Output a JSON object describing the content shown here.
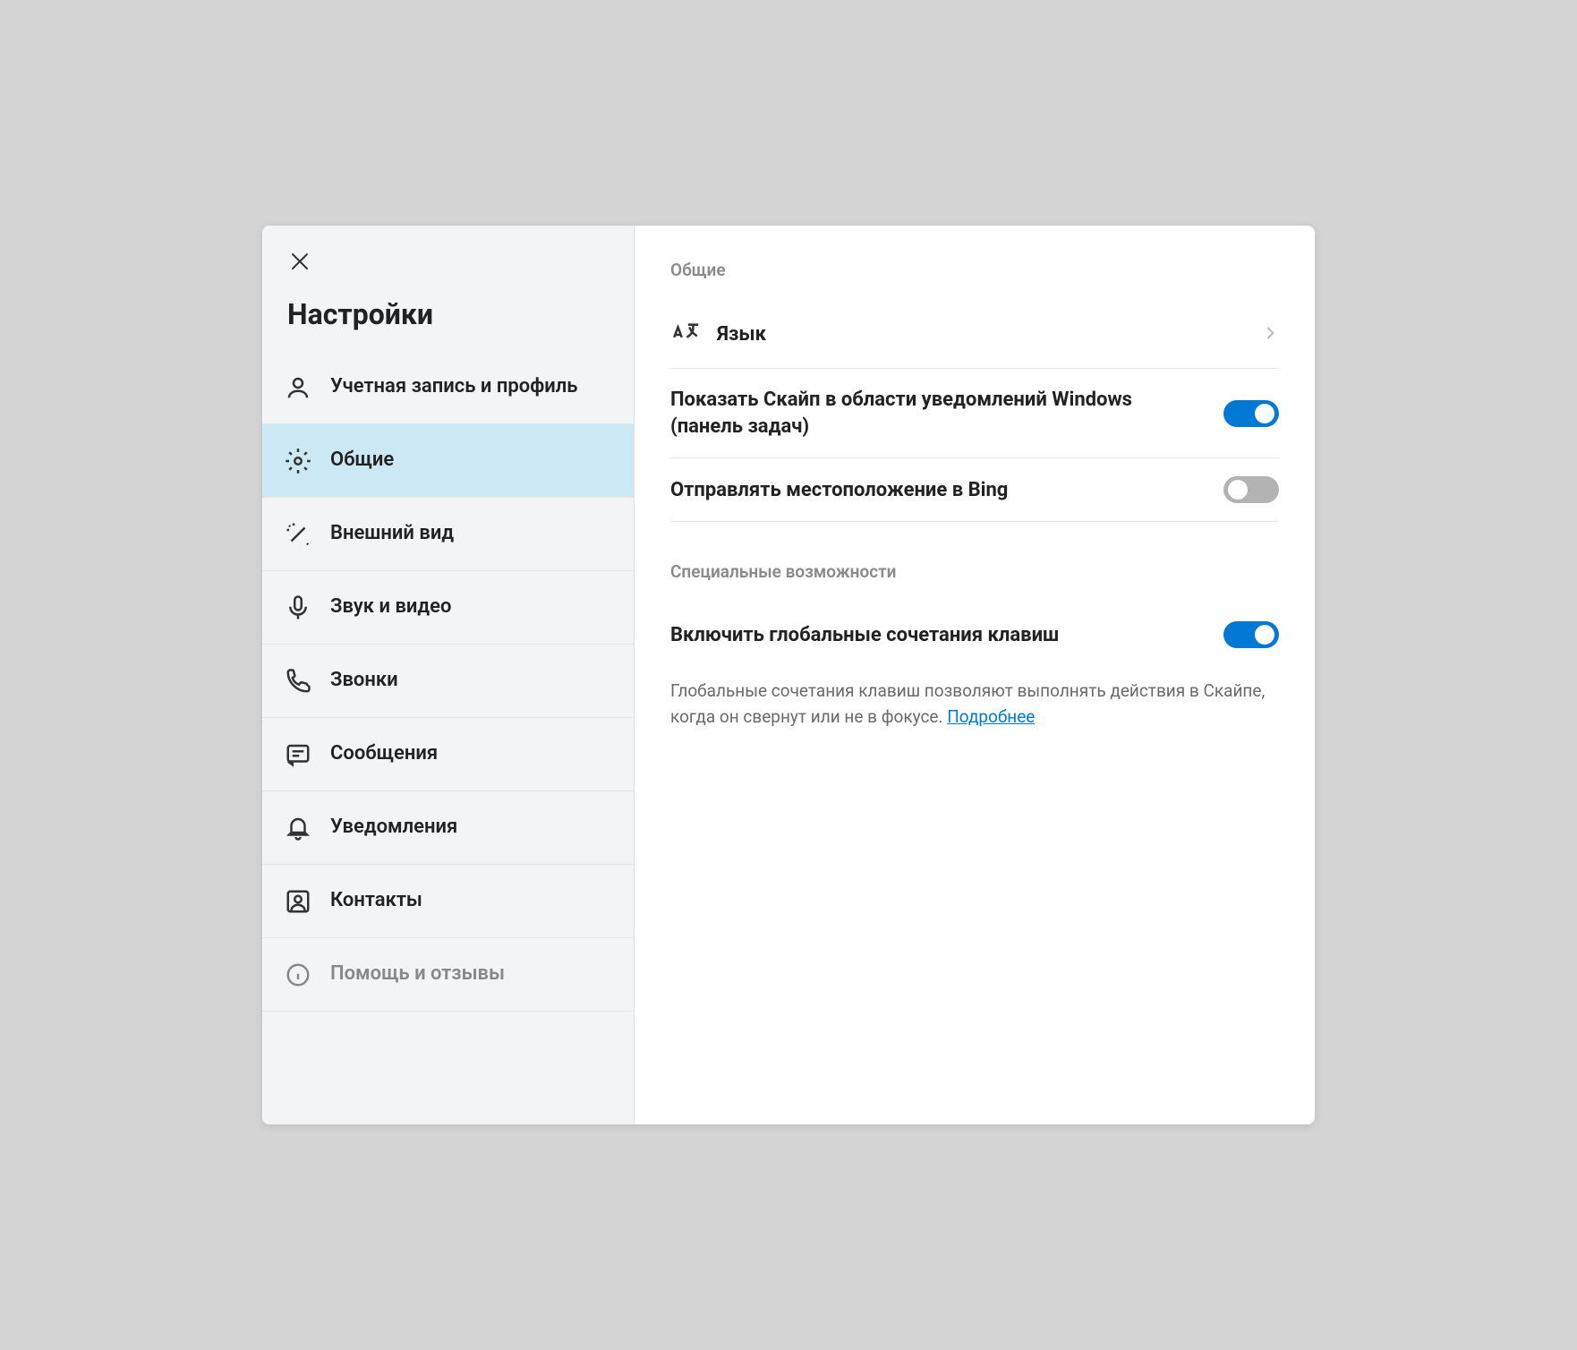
{
  "sidebar": {
    "title": "Настройки",
    "items": [
      {
        "label": "Учетная запись и профиль",
        "icon": "person"
      },
      {
        "label": "Общие",
        "icon": "gear",
        "selected": true
      },
      {
        "label": "Внешний вид",
        "icon": "wand"
      },
      {
        "label": "Звук и видео",
        "icon": "mic"
      },
      {
        "label": "Звонки",
        "icon": "phone"
      },
      {
        "label": "Сообщения",
        "icon": "chat"
      },
      {
        "label": "Уведомления",
        "icon": "bell"
      },
      {
        "label": "Контакты",
        "icon": "contact"
      },
      {
        "label": "Помощь и отзывы",
        "icon": "info",
        "disabled": true
      }
    ]
  },
  "main": {
    "section1": {
      "header": "Общие",
      "language": {
        "label": "Язык"
      },
      "tray": {
        "label": "Показать Скайп в области уведомлений Windows (панель задач)",
        "on": true
      },
      "bing": {
        "label": "Отправлять место­положение в Bing",
        "on": false
      }
    },
    "section2": {
      "header": "Специальные возможности",
      "hotkeys": {
        "label": "Включить глобальные сочетания клавиш",
        "on": true,
        "description": "Глобальные сочетания клавиш позволяют выполнять действия в Скайпе, когда он свернут или не в фокусе. ",
        "link": "Подробнее"
      }
    }
  }
}
